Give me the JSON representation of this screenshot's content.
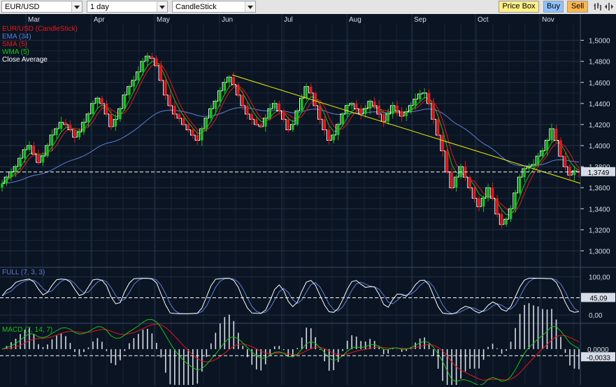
{
  "toolbar": {
    "symbol": "EUR/USD",
    "timeframe": "1 day",
    "chart_style": "CandleStick",
    "price_box_label": "Price Box",
    "buy_label": "Buy",
    "sell_label": "Sell",
    "icons": [
      "bar-chart-icon",
      "scroll-icon"
    ]
  },
  "legend": [
    {
      "text": "EUR/USD (CandleStick)",
      "color": "#e8161a"
    },
    {
      "text": "EMA (34)",
      "color": "#5d7fd6"
    },
    {
      "text": "SMA (5)",
      "color": "#e8161a"
    },
    {
      "text": "WMA (5)",
      "color": "#19c219"
    },
    {
      "text": "Close Average",
      "color": "#ffffff"
    }
  ],
  "colors": {
    "background": "#0b1422",
    "grid": "#223148",
    "candle_up": "#19c219",
    "candle_down": "#e8161a",
    "trendline": "#f0f000",
    "ema": "#5d7fd6",
    "close_average": "#ffffff",
    "label_fill": "#d7dde8"
  },
  "price_panel": {
    "current_price_label": "1,3749",
    "current_price": 1.3749,
    "y_range": [
      1.285,
      1.525
    ]
  },
  "stochastic_panel": {
    "label": "FULL (7, 3, 3)",
    "current_label": "45,09",
    "current": 45.09,
    "y_range": [
      -20,
      125
    ]
  },
  "macd_panel": {
    "label": "MACD (7, 14, 7)",
    "current_label": "-0,0033",
    "zero_label": "0,0000",
    "current": -0.0033,
    "y_range": [
      -0.018,
      0.013
    ]
  },
  "chart_data": [
    {
      "type": "candlestick",
      "title": "EUR/USD (CandleStick)",
      "series": [
        {
          "name": "EUR/USD (CandleStick)",
          "kind": "candles"
        },
        {
          "name": "EMA (34)",
          "kind": "line"
        },
        {
          "name": "SMA (5)",
          "kind": "line"
        },
        {
          "name": "WMA (5)",
          "kind": "line"
        },
        {
          "name": "Close Average",
          "kind": "line"
        }
      ],
      "x_labels": [
        "Mar",
        "Apr",
        "May",
        "Jun",
        "Jul",
        "Aug",
        "Sep",
        "Oct",
        "Nov"
      ],
      "y_ticks": [
        1.3,
        1.32,
        1.34,
        1.36,
        1.38,
        1.4,
        1.42,
        1.44,
        1.46,
        1.48,
        1.5
      ],
      "y_tick_labels": [
        "1,3000",
        "1,3200",
        "1,3400",
        "1,3600",
        "1,3800",
        "1,4000",
        "1,4200",
        "1,4400",
        "1,4600",
        "1,4800",
        "1,5000"
      ],
      "ylim": [
        1.285,
        1.525
      ],
      "grid": true,
      "closes": [
        1.364,
        1.37,
        1.375,
        1.38,
        1.388,
        1.396,
        1.4,
        1.392,
        1.384,
        1.39,
        1.4,
        1.41,
        1.416,
        1.422,
        1.42,
        1.415,
        1.408,
        1.413,
        1.422,
        1.43,
        1.44,
        1.445,
        1.44,
        1.43,
        1.418,
        1.425,
        1.435,
        1.448,
        1.456,
        1.462,
        1.47,
        1.48,
        1.485,
        1.483,
        1.476,
        1.462,
        1.448,
        1.438,
        1.43,
        1.426,
        1.42,
        1.415,
        1.41,
        1.405,
        1.416,
        1.426,
        1.435,
        1.442,
        1.452,
        1.46,
        1.465,
        1.458,
        1.448,
        1.438,
        1.43,
        1.425,
        1.42,
        1.418,
        1.426,
        1.435,
        1.44,
        1.433,
        1.425,
        1.415,
        1.42,
        1.433,
        1.445,
        1.456,
        1.45,
        1.438,
        1.425,
        1.415,
        1.405,
        1.41,
        1.42,
        1.43,
        1.438,
        1.44,
        1.435,
        1.43,
        1.435,
        1.442,
        1.438,
        1.43,
        1.423,
        1.43,
        1.438,
        1.433,
        1.428,
        1.432,
        1.438,
        1.444,
        1.449,
        1.45,
        1.44,
        1.425,
        1.41,
        1.395,
        1.375,
        1.36,
        1.37,
        1.38,
        1.37,
        1.36,
        1.35,
        1.342,
        1.35,
        1.36,
        1.35,
        1.335,
        1.325,
        1.33,
        1.34,
        1.355,
        1.37,
        1.378,
        1.38,
        1.382,
        1.39,
        1.395,
        1.405,
        1.416,
        1.405,
        1.39,
        1.38,
        1.372,
        1.376,
        1.3749
      ]
    },
    {
      "type": "line",
      "title": "FULL (7, 3, 3)",
      "series": [
        {
          "name": "FULL (7, 3, 3)"
        }
      ],
      "y_ticks": [
        0,
        45.09,
        100
      ],
      "y_tick_labels": [
        "0,00",
        "45,09",
        "100,00"
      ],
      "ylim": [
        -20,
        125
      ],
      "reference_line": 45.09
    },
    {
      "type": "bar",
      "title": "MACD (7, 14, 7)",
      "series": [
        {
          "name": "MACD (7, 14, 7)"
        }
      ],
      "y_ticks": [
        0,
        -0.0033
      ],
      "y_tick_labels": [
        "0,0000",
        "-0,0033"
      ],
      "ylim": [
        -0.018,
        0.013
      ],
      "reference_line": -0.0033
    }
  ]
}
